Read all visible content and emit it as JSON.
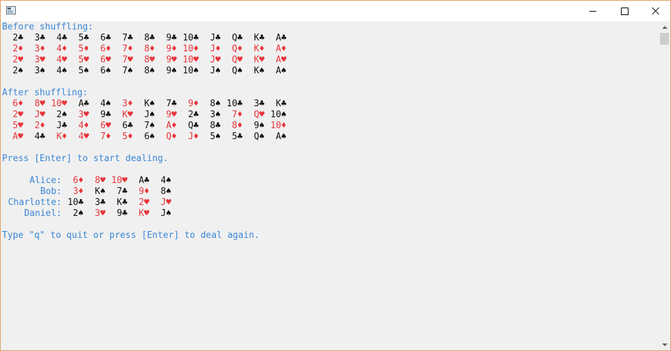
{
  "window": {
    "title": ""
  },
  "console": {
    "before_heading": "Before shuffling:",
    "before_rows": [
      [
        "2♣",
        "3♣",
        "4♣",
        "5♣",
        "6♣",
        "7♣",
        "8♣",
        "9♣",
        "10♣",
        "J♣",
        "Q♣",
        "K♣",
        "A♣"
      ],
      [
        "2♦",
        "3♦",
        "4♦",
        "5♦",
        "6♦",
        "7♦",
        "8♦",
        "9♦",
        "10♦",
        "J♦",
        "Q♦",
        "K♦",
        "A♦"
      ],
      [
        "2♥",
        "3♥",
        "4♥",
        "5♥",
        "6♥",
        "7♥",
        "8♥",
        "9♥",
        "10♥",
        "J♥",
        "Q♥",
        "K♥",
        "A♥"
      ],
      [
        "2♠",
        "3♠",
        "4♠",
        "5♠",
        "6♠",
        "7♠",
        "8♠",
        "9♠",
        "10♠",
        "J♠",
        "Q♠",
        "K♠",
        "A♠"
      ]
    ],
    "after_heading": "After shuffling:",
    "after_rows": [
      [
        "6♦",
        "8♥",
        "10♥",
        "A♣",
        "4♠",
        "3♦",
        "K♠",
        "7♣",
        "9♦",
        "8♠",
        "10♣",
        "3♣",
        "K♣"
      ],
      [
        "2♥",
        "J♥",
        "2♠",
        "3♥",
        "9♣",
        "K♥",
        "J♠",
        "9♥",
        "2♣",
        "3♠",
        "7♦",
        "Q♥",
        "10♠"
      ],
      [
        "5♥",
        "2♦",
        "J♣",
        "4♦",
        "6♥",
        "6♣",
        "7♠",
        "A♦",
        "Q♣",
        "8♣",
        "8♦",
        "9♠",
        "10♦"
      ],
      [
        "A♥",
        "4♣",
        "K♦",
        "4♥",
        "7♦",
        "5♦",
        "6♠",
        "Q♦",
        "J♦",
        "5♠",
        "5♣",
        "Q♠",
        "A♠"
      ]
    ],
    "prompt_deal": "Press [Enter] to start dealing.",
    "players": [
      {
        "name": "Alice:",
        "cards": [
          "6♦",
          "8♥",
          "10♥",
          "A♣",
          "4♠"
        ]
      },
      {
        "name": "Bob:",
        "cards": [
          "3♦",
          "K♠",
          "7♣",
          "9♦",
          "8♠"
        ]
      },
      {
        "name": "Charlotte:",
        "cards": [
          "10♣",
          "3♣",
          "K♣",
          "2♥",
          "J♥"
        ]
      },
      {
        "name": "Daniel:",
        "cards": [
          "2♠",
          "3♥",
          "9♣",
          "K♥",
          "J♠"
        ]
      }
    ],
    "prompt_again": "Type \"q\" to quit or press [Enter] to deal again."
  },
  "colors": {
    "prompt": "#3a86d6",
    "red_suit": "#e8353a",
    "black_suit": "#111111"
  },
  "icons": {
    "app": "console-app-icon",
    "minimize": "minimize-icon",
    "maximize": "maximize-icon",
    "close": "close-icon"
  }
}
